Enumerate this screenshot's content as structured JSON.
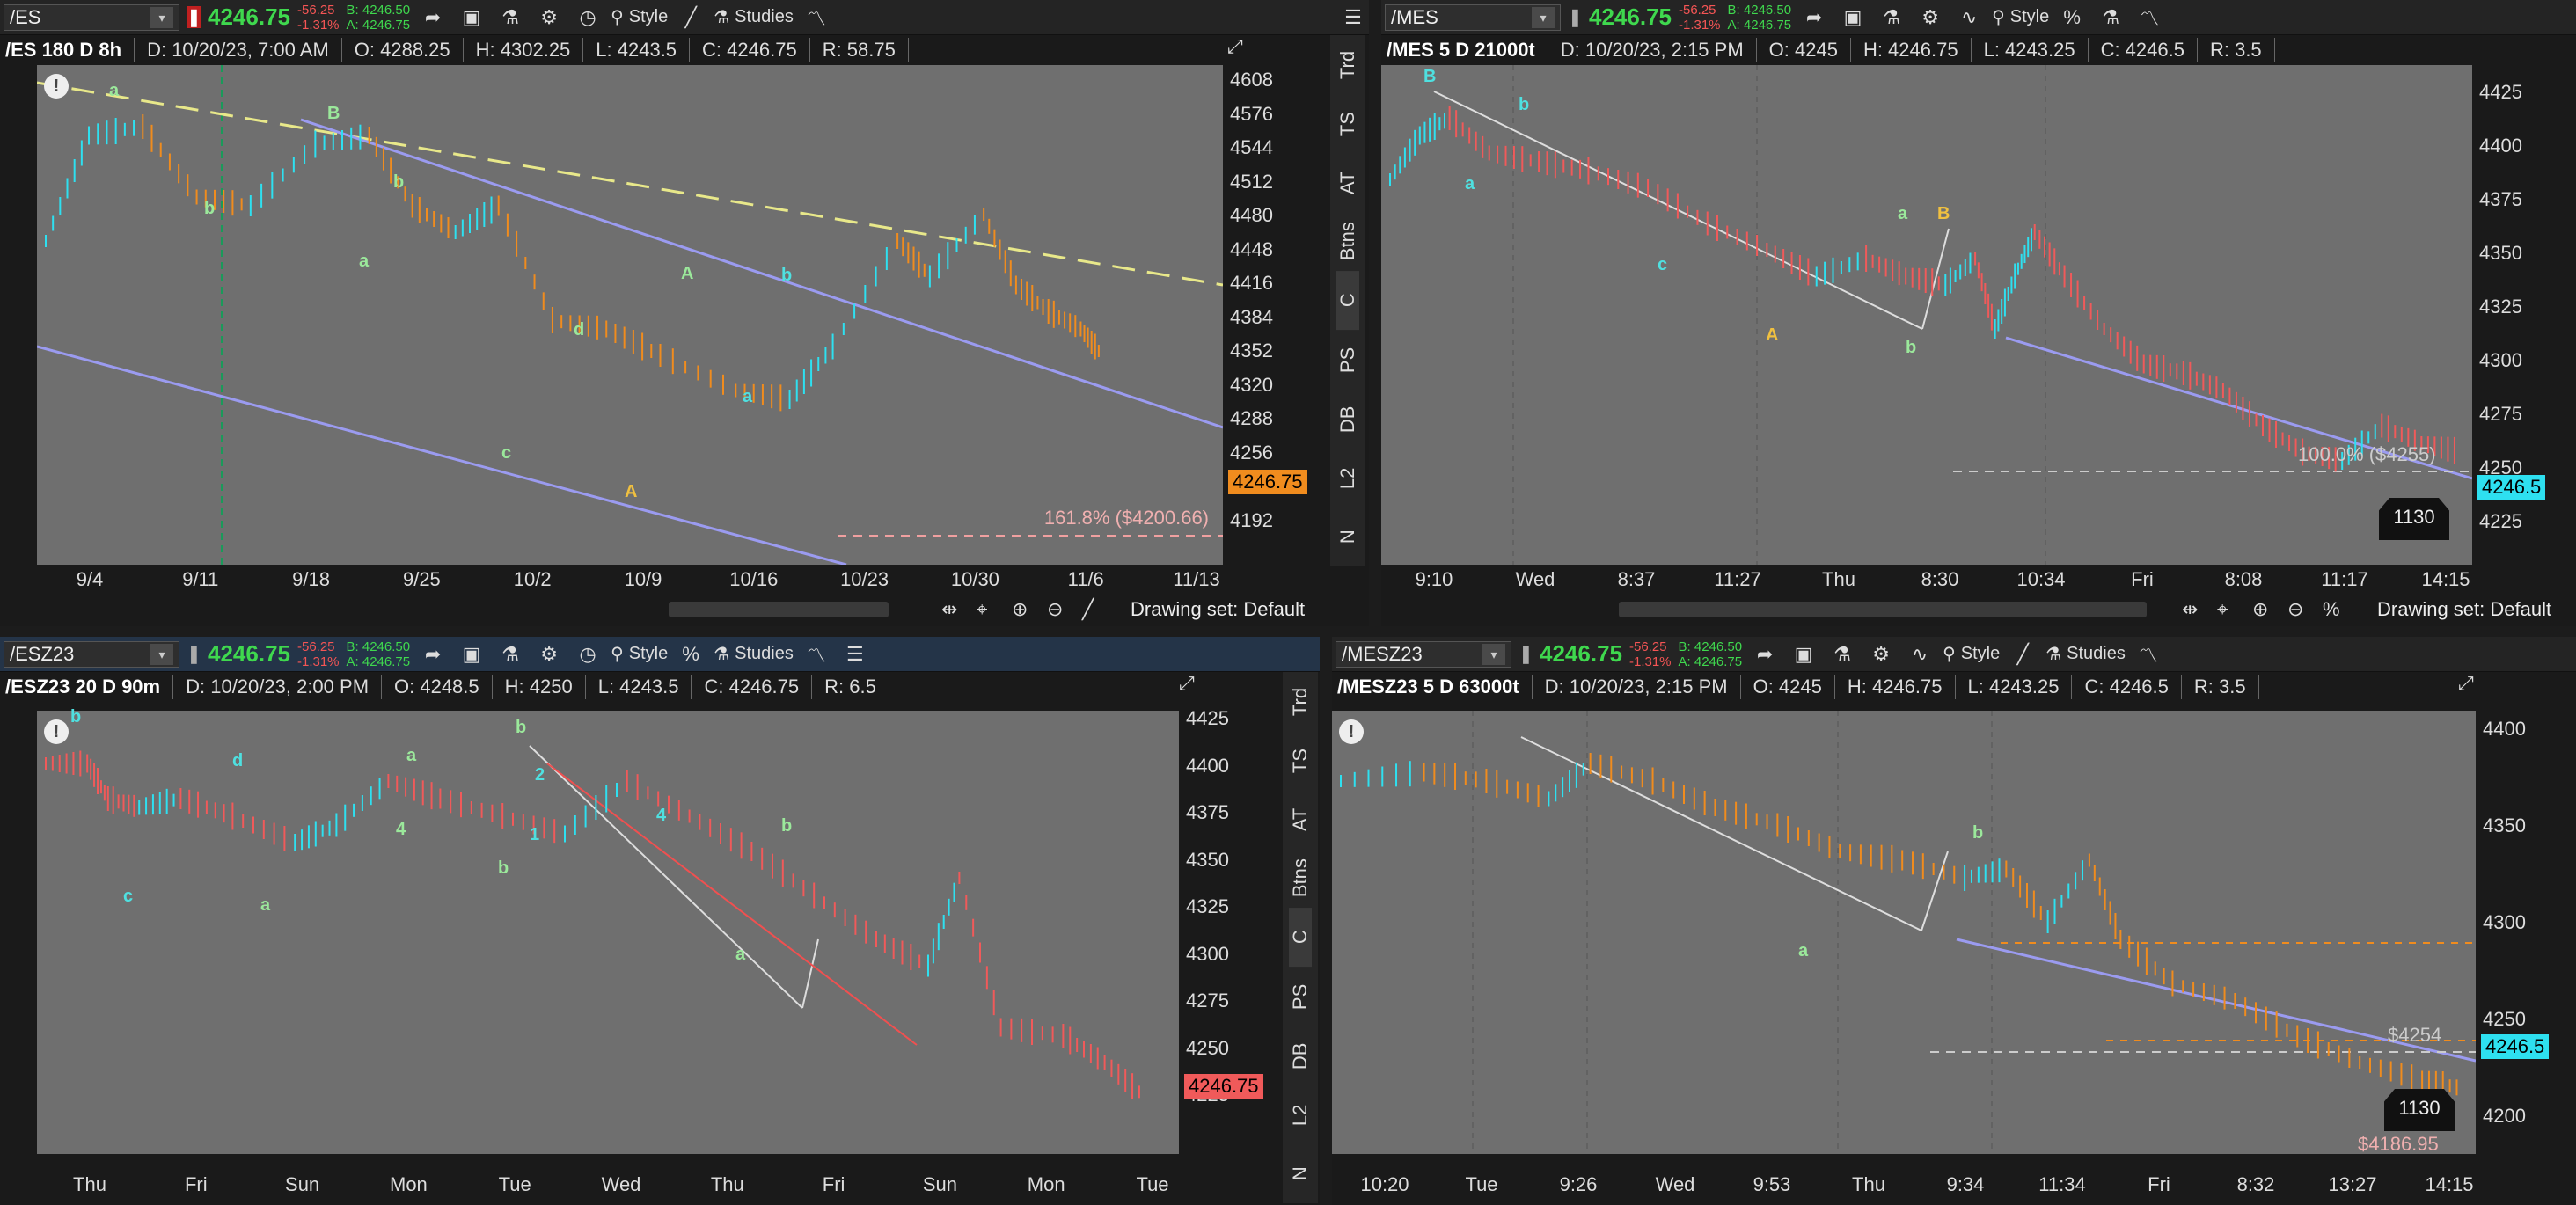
{
  "panels": [
    {
      "toolbar": {
        "symbol": "/ES",
        "price": "4246.75",
        "chg": "-56.25",
        "chgpct": "-1.31%",
        "bid": "B: 4246.50",
        "ask": "A: 4246.75",
        "style": "Style",
        "studies": "Studies"
      },
      "header": {
        "title": "/ES 180 D 8h",
        "d": "D: 10/20/23, 7:00 AM",
        "o": "O: 4288.25",
        "h": "H: 4302.25",
        "l": "L: 4243.5",
        "c": "C: 4246.75",
        "r": "R: 58.75"
      },
      "yticks": [
        "4608",
        "4576",
        "4544",
        "4512",
        "4480",
        "4448",
        "4416",
        "4384",
        "4352",
        "4320",
        "4288",
        "4256",
        "4224",
        "4192"
      ],
      "xticks": [
        "9/4",
        "9/11",
        "9/18",
        "9/25",
        "10/2",
        "10/9",
        "10/16",
        "10/23",
        "10/30",
        "11/6",
        "11/13"
      ],
      "price_tag": "4246.75",
      "fib": "161.8%  ($4200.66)",
      "side_tabs": [
        "Trd",
        "TS",
        "AT",
        "Btns",
        "C",
        "PS",
        "DB",
        "L2",
        "N"
      ],
      "drawing_set": "Drawing set: Default",
      "labels": [
        {
          "t": "a",
          "c": "#9be89b"
        },
        {
          "t": "b",
          "c": "#9be89b"
        },
        {
          "t": "B",
          "c": "#9be89b"
        },
        {
          "t": "b",
          "c": "#9be89b"
        },
        {
          "t": "a",
          "c": "#9be89b"
        },
        {
          "t": "d",
          "c": "#9be89b"
        },
        {
          "t": "c",
          "c": "#9be89b"
        },
        {
          "t": "A",
          "c": "#f0c040"
        },
        {
          "t": "A",
          "c": "#9be89b"
        },
        {
          "t": "b",
          "c": "#4fe0e0"
        },
        {
          "t": "a",
          "c": "#4fe0e0"
        }
      ]
    },
    {
      "toolbar": {
        "symbol": "/MES",
        "price": "4246.75",
        "chg": "-56.25",
        "chgpct": "-1.31%",
        "bid": "B: 4246.50",
        "ask": "A: 4246.75",
        "style": "Style",
        "studies": ""
      },
      "header": {
        "title": "/MES 5 D 21000t",
        "d": "D: 10/20/23, 2:15 PM",
        "o": "O: 4245",
        "h": "H: 4246.75",
        "l": "L: 4243.25",
        "c": "C: 4246.5",
        "r": "R: 3.5"
      },
      "yticks": [
        "4425",
        "4400",
        "4375",
        "4350",
        "4325",
        "4300",
        "4275",
        "4250",
        "4225"
      ],
      "xticks": [
        "9:10",
        "Wed",
        "8:37",
        "11:27",
        "Thu",
        "8:30",
        "10:34",
        "Fri",
        "8:08",
        "11:17",
        "14:15"
      ],
      "price_tag": "4246.5",
      "fib": "100.0%  ($4255)",
      "badge": "1130",
      "drawing_set": "Drawing set: Default",
      "labels": [
        {
          "t": "B",
          "c": "#4fe0e0"
        },
        {
          "t": "b",
          "c": "#4fe0e0"
        },
        {
          "t": "a",
          "c": "#4fe0e0"
        },
        {
          "t": "c",
          "c": "#4fe0e0"
        },
        {
          "t": "a",
          "c": "#9be89b"
        },
        {
          "t": "B",
          "c": "#f0c040"
        },
        {
          "t": "A",
          "c": "#f0c040"
        },
        {
          "t": "b",
          "c": "#9be89b"
        }
      ]
    },
    {
      "toolbar": {
        "symbol": "/ESZ23",
        "price": "4246.75",
        "chg": "-56.25",
        "chgpct": "-1.31%",
        "bid": "B: 4246.50",
        "ask": "A: 4246.75",
        "style": "Style",
        "studies": "Studies"
      },
      "header": {
        "title": "/ESZ23 20 D 90m",
        "d": "D: 10/20/23, 2:00 PM",
        "o": "O: 4248.5",
        "h": "H: 4250",
        "l": "L: 4243.5",
        "c": "C: 4246.75",
        "r": "R: 6.5"
      },
      "yticks": [
        "4425",
        "4400",
        "4375",
        "4350",
        "4325",
        "4300",
        "4275",
        "4250",
        "4225"
      ],
      "xticks": [
        "Thu",
        "Fri",
        "Sun",
        "Mon",
        "Tue",
        "Wed",
        "Thu",
        "Fri",
        "Sun",
        "Mon",
        "Tue"
      ],
      "price_tag": "4246.75",
      "side_tabs": [
        "Trd",
        "TS",
        "AT",
        "Btns",
        "C",
        "PS",
        "DB",
        "L2",
        "N"
      ],
      "labels": [
        {
          "t": "b",
          "c": "#4fe0e0"
        },
        {
          "t": "d",
          "c": "#4fe0e0"
        },
        {
          "t": "c",
          "c": "#4fe0e0"
        },
        {
          "t": "a",
          "c": "#9be89b"
        },
        {
          "t": "a",
          "c": "#9be89b"
        },
        {
          "t": "4",
          "c": "#9be89b"
        },
        {
          "t": "b",
          "c": "#9be89b"
        },
        {
          "t": "2",
          "c": "#4fe0e0"
        },
        {
          "t": "1",
          "c": "#4fe0e0"
        },
        {
          "t": "b",
          "c": "#9be89b"
        },
        {
          "t": "4",
          "c": "#4fe0e0"
        },
        {
          "t": "a",
          "c": "#9be89b"
        },
        {
          "t": "b",
          "c": "#9be89b"
        }
      ]
    },
    {
      "toolbar": {
        "symbol": "/MESZ23",
        "price": "4246.75",
        "chg": "-56.25",
        "chgpct": "-1.31%",
        "bid": "B: 4246.50",
        "ask": "A: 4246.75",
        "style": "Style",
        "studies": "Studies"
      },
      "header": {
        "title": "/MESZ23 5 D 63000t",
        "d": "D: 10/20/23, 2:15 PM",
        "o": "O: 4245",
        "h": "H: 4246.75",
        "l": "L: 4243.25",
        "c": "C: 4246.5",
        "r": "R: 3.5"
      },
      "yticks": [
        "4400",
        "4350",
        "4300",
        "4250",
        "4200"
      ],
      "xticks": [
        "10:20",
        "Tue",
        "9:26",
        "Wed",
        "9:53",
        "Thu",
        "9:34",
        "11:34",
        "Fri",
        "8:32",
        "13:27",
        "14:15"
      ],
      "price_tag": "4246.5",
      "fib": "$4254",
      "fib2": "$4186.95",
      "badge": "1130",
      "labels": [
        {
          "t": "a",
          "c": "#9be89b"
        },
        {
          "t": "b",
          "c": "#9be89b"
        }
      ]
    }
  ]
}
